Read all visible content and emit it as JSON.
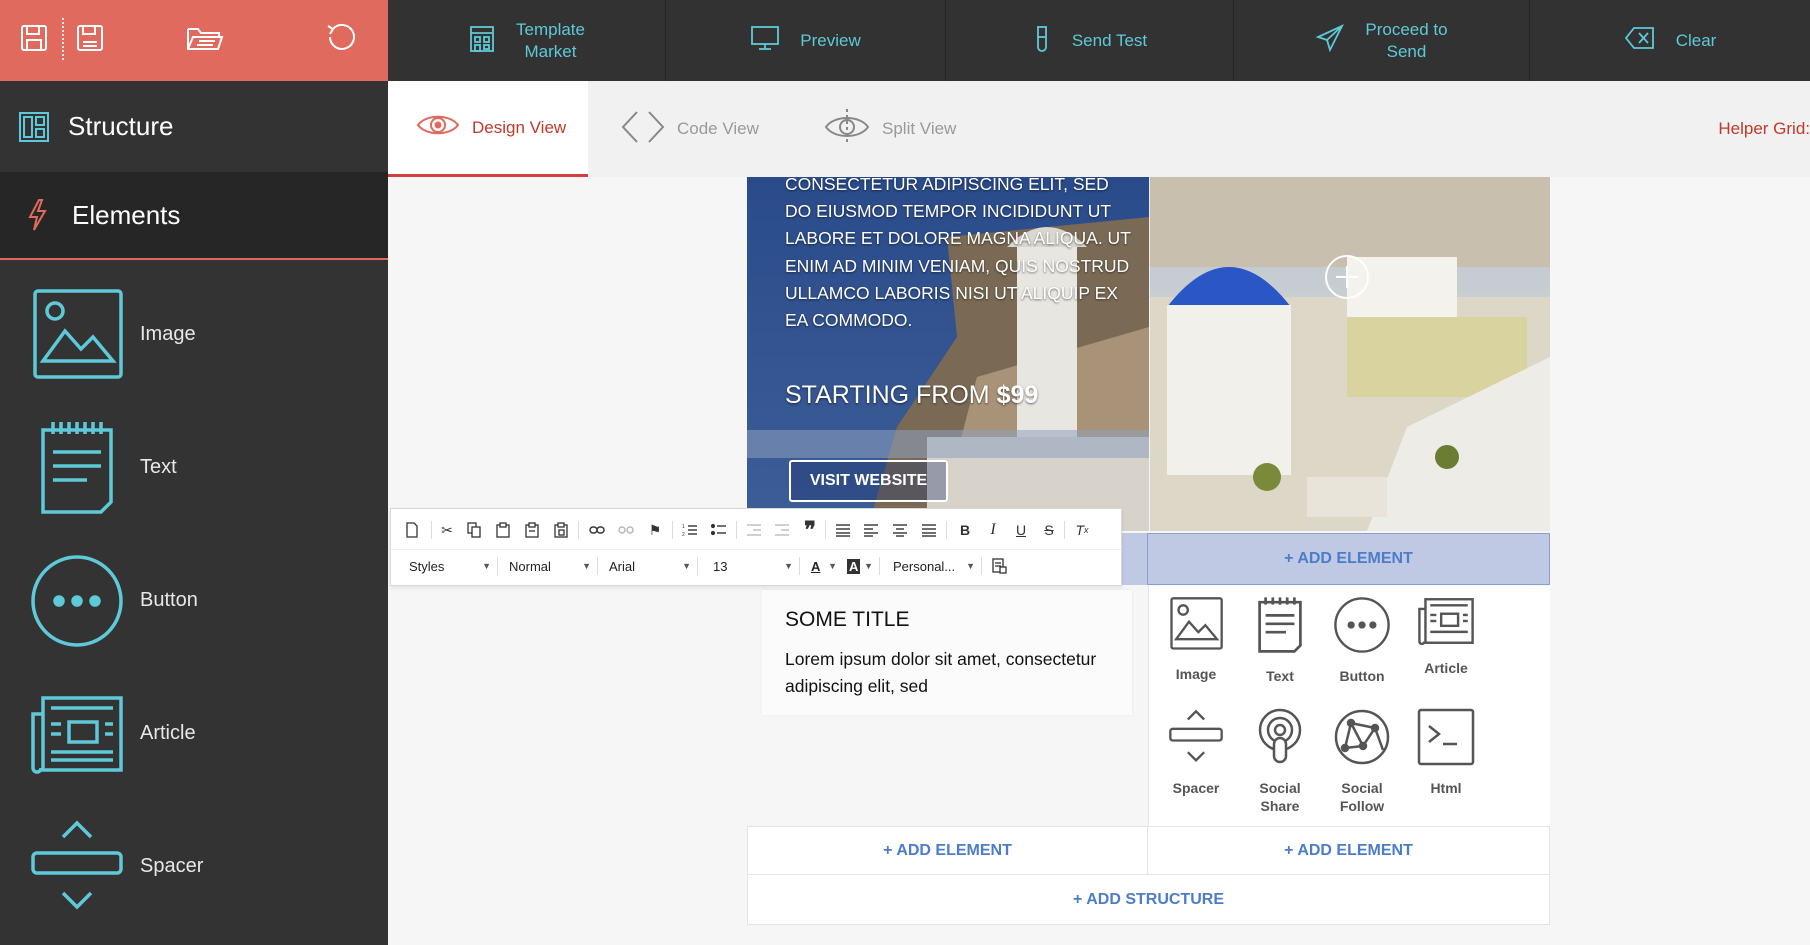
{
  "topleft": {
    "icons": [
      "save-icon",
      "save-as-icon",
      "open-folder-icon",
      "undo-icon"
    ]
  },
  "toolbar": {
    "template_market": "Template\nMarket",
    "preview": "Preview",
    "send_test": "Send Test",
    "proceed": "Proceed to\nSend",
    "clear": "Clear"
  },
  "sidebar": {
    "structure": "Structure",
    "elements": "Elements",
    "items": [
      {
        "label": "Image",
        "icon": "image-icon"
      },
      {
        "label": "Text",
        "icon": "text-icon"
      },
      {
        "label": "Button",
        "icon": "button-icon"
      },
      {
        "label": "Article",
        "icon": "article-icon"
      },
      {
        "label": "Spacer",
        "icon": "spacer-icon"
      }
    ]
  },
  "tabs": {
    "design": "Design View",
    "code": "Code View",
    "split": "Split View",
    "helper": "Helper Grid:"
  },
  "hero": {
    "body": "CONSECTETUR ADIPISCING ELIT, SED DO EIUSMOD TEMPOR INCIDIDUNT UT LABORE ET DOLORE MAGNA ALIQUA. UT ENIM AD MINIM VENIAM, QUIS NOSTRUD ULLAMCO LABORIS NISI UT ALIQUIP EX EA COMMODO.",
    "starting": "STARTING FROM",
    "price": "$99",
    "visit": "VISIT WEBSITE"
  },
  "rte": {
    "styles": "Styles",
    "format": "Normal",
    "font": "Arial",
    "size": "13",
    "personal": "Personal..."
  },
  "content": {
    "title": "SOME TITLE",
    "body": "Lorem ipsum dolor sit amet, consectetur adipiscing elit, sed"
  },
  "add_element": "+ ADD ELEMENT",
  "add_structure": "+ ADD STRUCTURE",
  "palette": [
    {
      "label": "Image",
      "icon": "image-icon"
    },
    {
      "label": "Text",
      "icon": "text-icon"
    },
    {
      "label": "Button",
      "icon": "button-icon"
    },
    {
      "label": "Article",
      "icon": "article-icon"
    },
    {
      "label": "Spacer",
      "icon": "spacer-icon"
    },
    {
      "label": "Social\nShare",
      "icon": "social-share-icon"
    },
    {
      "label": "Social\nFollow",
      "icon": "social-follow-icon"
    },
    {
      "label": "Html",
      "icon": "html-icon"
    }
  ],
  "colors": {
    "accent": "#e06a5d",
    "teal": "#5ec9d8",
    "dark": "#323232",
    "link": "#4d7cc9"
  }
}
